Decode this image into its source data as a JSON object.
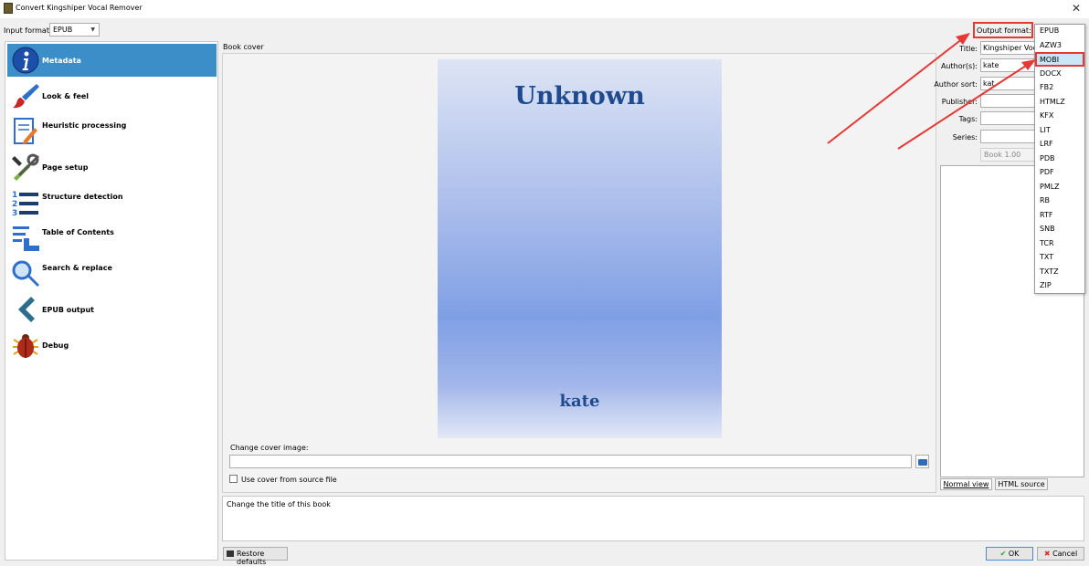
{
  "window": {
    "title": "Convert Kingshiper Vocal Remover",
    "close_symbol": "✕"
  },
  "input_format": {
    "label": "Input format:",
    "value": "EPUB"
  },
  "sidebar": {
    "items": [
      {
        "label": "Metadata",
        "icon": "info-icon",
        "active": true
      },
      {
        "label": "Look & feel",
        "icon": "paintbrush-icon"
      },
      {
        "label": "Heuristic processing",
        "icon": "document-pencil-icon"
      },
      {
        "label": "Page setup",
        "icon": "tools-icon"
      },
      {
        "label": "Structure detection",
        "icon": "numbered-list-icon"
      },
      {
        "label": "Table of Contents",
        "icon": "toc-icon"
      },
      {
        "label": "Search & replace",
        "icon": "magnifier-icon"
      },
      {
        "label": "EPUB output",
        "icon": "chevron-left-icon"
      },
      {
        "label": "Debug",
        "icon": "bug-icon"
      }
    ]
  },
  "cover": {
    "section_label": "Book cover",
    "title_text": "Unknown",
    "author_text": "kate",
    "change_label": "Change cover image:",
    "path_value": "",
    "use_source_label": "Use cover from source file"
  },
  "metadata_form": {
    "title_label": "Title:",
    "title_value": "Kingshiper Vocal",
    "authors_label": "Author(s):",
    "authors_value": "kate",
    "author_sort_label": "Author sort:",
    "author_sort_value": "kat",
    "publisher_label": "Publisher:",
    "publisher_value": "",
    "tags_label": "Tags:",
    "tags_value": "",
    "series_label": "Series:",
    "series_value": "",
    "series_index": "Book 1.00"
  },
  "comments": {
    "tab_normal": "Normal view",
    "tab_html": "HTML source"
  },
  "output_format": {
    "label": "Output format:",
    "selected": "MOBI",
    "options": [
      "EPUB",
      "AZW3",
      "MOBI",
      "DOCX",
      "FB2",
      "HTMLZ",
      "KFX",
      "LIT",
      "LRF",
      "PDB",
      "PDF",
      "PMLZ",
      "RB",
      "RTF",
      "SNB",
      "TCR",
      "TXT",
      "TXTZ",
      "ZIP"
    ]
  },
  "hint": {
    "text": "Change the title of this book"
  },
  "footer": {
    "restore_label": "Restore defaults",
    "ok_label": "OK",
    "cancel_label": "Cancel"
  },
  "colors": {
    "accent": "#3c8ec8",
    "annotation": "#e53935",
    "cover_text": "#1f4a8e"
  }
}
